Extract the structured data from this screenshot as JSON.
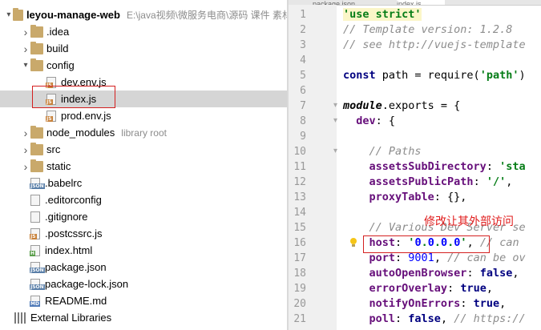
{
  "project": {
    "root_name": "leyou-manage-web",
    "root_path": "E:\\java视频\\微服务电商\\源码 课件 素材"
  },
  "tree": [
    {
      "label": "leyou-manage-web",
      "kind": "folder",
      "expanded": true,
      "depth": 0
    },
    {
      "label": ".idea",
      "kind": "folder",
      "expanded": false,
      "depth": 1
    },
    {
      "label": "build",
      "kind": "folder",
      "expanded": false,
      "depth": 1
    },
    {
      "label": "config",
      "kind": "folder",
      "expanded": true,
      "depth": 1
    },
    {
      "label": "dev.env.js",
      "kind": "js",
      "depth": 2
    },
    {
      "label": "index.js",
      "kind": "js",
      "depth": 2,
      "selected": true
    },
    {
      "label": "prod.env.js",
      "kind": "js",
      "depth": 2
    },
    {
      "label": "node_modules",
      "kind": "folder",
      "expanded": false,
      "depth": 1,
      "suffix": "library root"
    },
    {
      "label": "src",
      "kind": "folder",
      "expanded": false,
      "depth": 1
    },
    {
      "label": "static",
      "kind": "folder",
      "expanded": false,
      "depth": 1
    },
    {
      "label": ".babelrc",
      "kind": "json",
      "depth": 1
    },
    {
      "label": ".editorconfig",
      "kind": "plain",
      "depth": 1
    },
    {
      "label": ".gitignore",
      "kind": "plain",
      "depth": 1
    },
    {
      "label": ".postcssrc.js",
      "kind": "js",
      "depth": 1
    },
    {
      "label": "index.html",
      "kind": "html",
      "depth": 1
    },
    {
      "label": "package.json",
      "kind": "json",
      "depth": 1
    },
    {
      "label": "package-lock.json",
      "kind": "json",
      "depth": 1
    },
    {
      "label": "README.md",
      "kind": "md",
      "depth": 1
    },
    {
      "label": "External Libraries",
      "kind": "lib",
      "depth": 0
    }
  ],
  "editor": {
    "tabs": [
      "package.json",
      "index.js"
    ],
    "line_numbers": [
      "1",
      "2",
      "3",
      "4",
      "5",
      "6",
      "7",
      "8",
      "9",
      "10",
      "11",
      "12",
      "13",
      "14",
      "15",
      "16",
      "17",
      "18",
      "19",
      "20",
      "21"
    ],
    "annotation": "修改让其外部访问"
  },
  "code_lines": [
    "'use strict'",
    "// Template version: 1.2.8",
    "// see http://vuejs-template",
    "",
    "const path = require('path')",
    "",
    "module.exports = {",
    "  dev: {",
    "",
    "    // Paths",
    "    assetsSubDirectory: 'sta",
    "    assetsPublicPath: '/',",
    "    proxyTable: {},",
    "",
    "    // Various Dev Server se",
    "    host: '0.0.0.0', // can",
    "    port: 9001, // can be ov",
    "    autoOpenBrowser: false,",
    "    errorOverlay: true,",
    "    notifyOnErrors: true,",
    "    poll: false, // https://"
  ],
  "colors": {
    "annotation": "#e01b1b",
    "string": "#067d17",
    "comment": "#8c8c8c",
    "keyword": "#000080",
    "property": "#660e7a",
    "number": "#0000ff"
  }
}
